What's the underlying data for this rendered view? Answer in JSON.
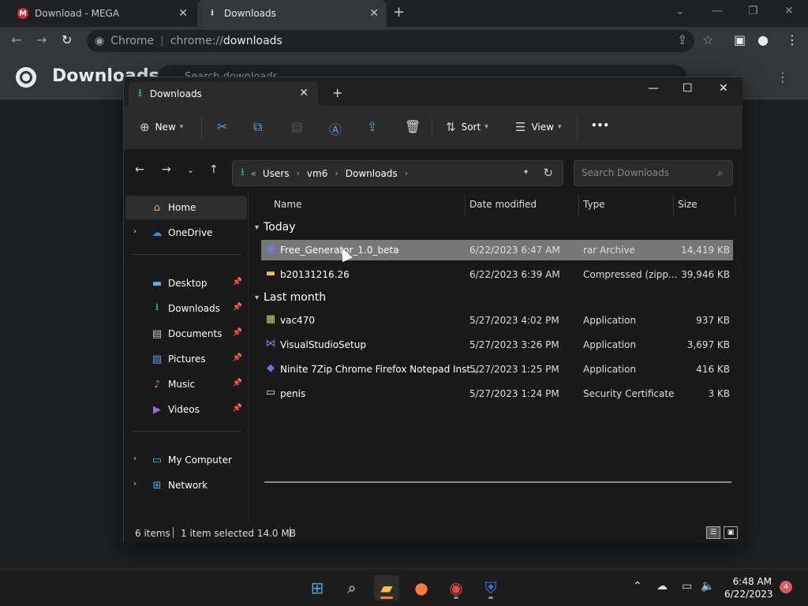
{
  "chrome": {
    "tabs": [
      {
        "title": "Download - MEGA",
        "favicon": "mega-icon"
      },
      {
        "title": "Downloads",
        "favicon": "download-icon"
      }
    ],
    "omnibox": {
      "site_label": "Chrome",
      "url_scheme": "chrome://",
      "url_path": "downloads"
    },
    "page_title": "Downloads",
    "search_placeholder": "Search downloads"
  },
  "explorer": {
    "tab_title": "Downloads",
    "commands": {
      "new": "New",
      "sort": "Sort",
      "view": "View",
      "more": "•••"
    },
    "breadcrumb": {
      "overflow": "«",
      "items": [
        "Users",
        "vm6",
        "Downloads"
      ]
    },
    "search_placeholder": "Search Downloads",
    "nav_pane": {
      "home": "Home",
      "onedrive": "OneDrive",
      "pinned": [
        "Desktop",
        "Downloads",
        "Documents",
        "Pictures",
        "Music",
        "Videos"
      ],
      "computer": "My Computer",
      "network": "Network"
    },
    "columns": {
      "name": "Name",
      "date": "Date modified",
      "type": "Type",
      "size": "Size"
    },
    "groups": [
      {
        "label": "Today",
        "files": [
          {
            "name": "Free_Generator_1.0_beta",
            "date": "6/22/2023 6:47 AM",
            "type": "rar Archive",
            "size": "14,419 KB",
            "icon": "rar-archive-icon",
            "selected": true
          },
          {
            "name": "b20131216.26",
            "date": "6/22/2023 6:39 AM",
            "type": "Compressed (zipp...",
            "size": "39,946 KB",
            "icon": "zip-folder-icon",
            "selected": false
          }
        ]
      },
      {
        "label": "Last month",
        "files": [
          {
            "name": "vac470",
            "date": "5/27/2023 4:02 PM",
            "type": "Application",
            "size": "937 KB",
            "icon": "application-icon",
            "selected": false
          },
          {
            "name": "VisualStudioSetup",
            "date": "5/27/2023 3:26 PM",
            "type": "Application",
            "size": "3,697 KB",
            "icon": "visual-studio-icon",
            "selected": false
          },
          {
            "name": "Ninite 7Zip Chrome Firefox Notepad Inst...",
            "date": "5/27/2023 1:25 PM",
            "type": "Application",
            "size": "416 KB",
            "icon": "ninite-icon",
            "selected": false
          },
          {
            "name": "penis",
            "date": "5/27/2023 1:24 PM",
            "type": "Security Certificate",
            "size": "3 KB",
            "icon": "certificate-icon",
            "selected": false
          }
        ]
      }
    ],
    "status": {
      "items": "6 items",
      "selection": "1 item selected  14.0 MB"
    }
  },
  "taskbar": {
    "time": "6:48 AM",
    "date": "6/22/2023",
    "notification_count": "4"
  },
  "colors": {
    "accent_green": "#3fbf7f",
    "selection": "#777777",
    "taskbar_active": "#ff7a3c"
  }
}
